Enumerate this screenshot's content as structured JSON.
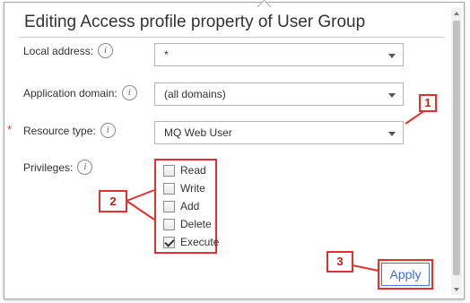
{
  "dialog": {
    "title": "Editing Access profile property of User Group"
  },
  "fields": {
    "local_address": {
      "label": "Local address:",
      "value": "*"
    },
    "application_domain": {
      "label": "Application domain:",
      "value": "(all domains)"
    },
    "resource_type": {
      "label": "Resource type:",
      "value": "MQ Web User",
      "required_marker": "*"
    },
    "privileges": {
      "label": "Privileges:"
    }
  },
  "info_icon_glyph": "i",
  "privileges": [
    {
      "label": "Read",
      "checked": false
    },
    {
      "label": "Write",
      "checked": false
    },
    {
      "label": "Add",
      "checked": false
    },
    {
      "label": "Delete",
      "checked": false
    },
    {
      "label": "Execute",
      "checked": true
    }
  ],
  "callouts": {
    "one": "1",
    "two": "2",
    "three": "3"
  },
  "buttons": {
    "apply": "Apply"
  },
  "colors": {
    "annotation_red": "#e23030",
    "apply_blue": "#3b6fd6",
    "required_red": "#d43c2e"
  }
}
